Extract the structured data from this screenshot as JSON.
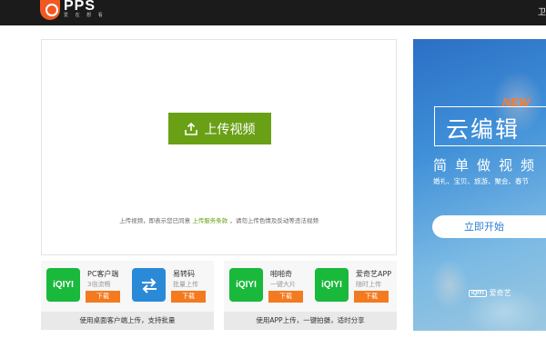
{
  "header": {
    "brand": "PPS",
    "brand_tagline": "爱 在 想 看",
    "right_link": "卫",
    "colors": {
      "bar": "#1b1b1b",
      "logo": "#f05a22"
    }
  },
  "upload": {
    "button_label": "上传视频",
    "button_icon": "upload-icon",
    "terms_prefix": "上传视频，即表示您已同意",
    "terms_link": "上传服务条款",
    "terms_suffix": "，请勿上传色情及反动等违法视频",
    "accent": "#6aa016"
  },
  "desktop_apps": {
    "apps": [
      {
        "name": "PC客户端",
        "desc": "3倍流畅",
        "download": "下载",
        "icon": "iqiyi-icon"
      },
      {
        "name": "易转码",
        "desc": "批量上传",
        "download": "下载",
        "icon": "transcode-icon"
      }
    ],
    "footer": "使用桌面客户端上传，支持批量"
  },
  "mobile_apps": {
    "apps": [
      {
        "name": "啪啪奇",
        "desc": "一键大片",
        "download": "下载",
        "icon": "papaqi-icon"
      },
      {
        "name": "爱奇艺APP",
        "desc": "随时上传",
        "download": "下载",
        "icon": "iqiyi-app-icon"
      }
    ],
    "footer": "使用APP上传，一键拍摄，适时分享"
  },
  "ad": {
    "badge": "NEW",
    "title": "云编辑",
    "subtitle": "简单做视频",
    "tags": "婚礼、宝贝、旅游、聚会、春节",
    "cta": "立即开始",
    "brand": "爱奇艺",
    "brand_mark": "iQIYI"
  }
}
